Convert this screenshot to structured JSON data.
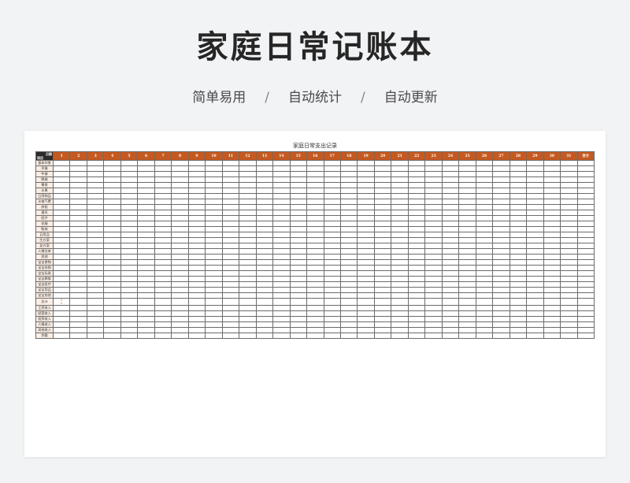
{
  "header": {
    "title": "家庭日常记账本",
    "features": [
      "简单易用",
      "自动统计",
      "自动更新"
    ],
    "separator": "/"
  },
  "sheet": {
    "title": "家庭日常支出记录",
    "corner_top": "日期",
    "corner_bottom": "项目",
    "day_columns": [
      "1",
      "2",
      "3",
      "4",
      "5",
      "6",
      "7",
      "8",
      "9",
      "10",
      "11",
      "12",
      "13",
      "14",
      "15",
      "16",
      "17",
      "18",
      "19",
      "20",
      "21",
      "22",
      "23",
      "24",
      "25",
      "26",
      "27",
      "28",
      "29",
      "30",
      "31"
    ],
    "total_column": "合计",
    "expense_categories": [
      "基本伙食",
      "早餐",
      "午餐",
      "晚餐",
      "零食",
      "水果",
      "日用物品",
      "水电气费",
      "房租",
      "通讯",
      "医疗",
      "衣服",
      "鞋袜",
      "日用品",
      "生方案",
      "女方案",
      "人情往来",
      "其他",
      "宝宝食物",
      "宝宝衣物",
      "宝宝玩具",
      "宝宝教育",
      "宝宝医疗",
      "宝宝用品",
      "宝宝其他"
    ],
    "expense_total_label": "总计",
    "total_marks": [
      "0",
      "0"
    ],
    "income_categories": [
      "工资收入",
      "经营收入",
      "投资收入",
      "人情收入",
      "其他收入",
      "余额"
    ]
  },
  "colors": {
    "header_accent": "#c55a21",
    "category_fill": "#fbeee5",
    "corner_fill": "#2b2b2b",
    "page_background": "#f2f3f5"
  }
}
